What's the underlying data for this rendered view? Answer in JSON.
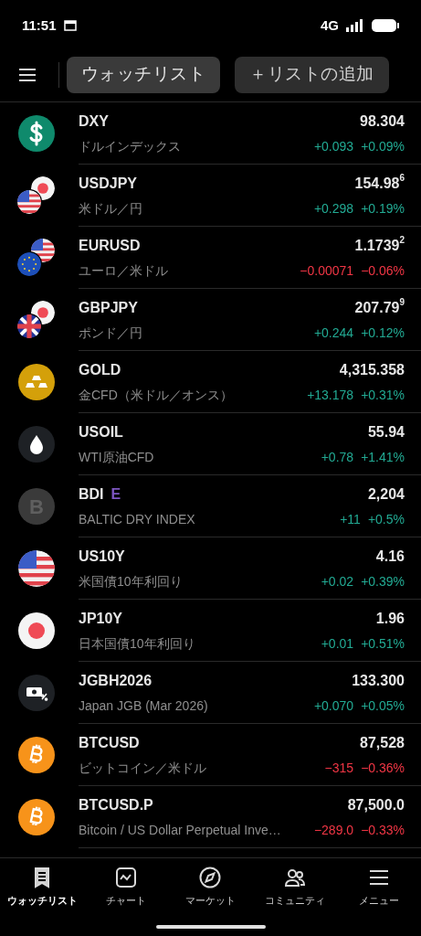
{
  "status_bar": {
    "time": "11:51",
    "network": "4G"
  },
  "header": {
    "tabs": [
      {
        "label": "ウォッチリスト",
        "selected": true
      },
      {
        "label": "＋リストの追加",
        "selected": false
      }
    ]
  },
  "rows": [
    {
      "kind": "dollar",
      "symbol": "DXY",
      "name": "ドルインデックス",
      "price": "98.304",
      "change": "+0.093",
      "percent": "+0.09%",
      "negative": false
    },
    {
      "kind": "usd_jpy",
      "symbol": "USDJPY",
      "name": "米ドル／円",
      "price": "154.98",
      "price_sup": "6",
      "change": "+0.298",
      "percent": "+0.19%",
      "negative": false
    },
    {
      "kind": "eur_usd",
      "symbol": "EURUSD",
      "name": "ユーロ／米ドル",
      "price": "1.1739",
      "price_sup": "2",
      "change": "−0.00071",
      "percent": "−0.06%",
      "negative": true
    },
    {
      "kind": "gbp_jpy",
      "symbol": "GBPJPY",
      "name": "ポンド／円",
      "price": "207.79",
      "price_sup": "9",
      "change": "+0.244",
      "percent": "+0.12%",
      "negative": false
    },
    {
      "kind": "gold",
      "symbol": "GOLD",
      "name": "金CFD（米ドル／オンス）",
      "price": "4,315.358",
      "change": "+13.178",
      "percent": "+0.31%",
      "negative": false
    },
    {
      "kind": "oil",
      "symbol": "USOIL",
      "name": "WTI原油CFD",
      "price": "55.94",
      "change": "+0.78",
      "percent": "+1.41%",
      "negative": false
    },
    {
      "kind": "letter",
      "letter": "B",
      "symbol": "BDI",
      "badge": "E",
      "name": "BALTIC DRY INDEX",
      "price": "2,204",
      "change": "+11",
      "percent": "+0.5%",
      "negative": false
    },
    {
      "kind": "us",
      "symbol": "US10Y",
      "name": "米国債10年利回り",
      "price": "4.16",
      "change": "+0.02",
      "percent": "+0.39%",
      "negative": false
    },
    {
      "kind": "jp",
      "symbol": "JP10Y",
      "name": "日本国債10年利回り",
      "price": "1.96",
      "change": "+0.01",
      "percent": "+0.51%",
      "negative": false
    },
    {
      "kind": "bond",
      "symbol": "JGBH2026",
      "name": "Japan JGB (Mar 2026)",
      "price": "133.300",
      "change": "+0.070",
      "percent": "+0.05%",
      "negative": false
    },
    {
      "kind": "bitcoin",
      "symbol": "BTCUSD",
      "name": "ビットコイン／米ドル",
      "price": "87,528",
      "change": "−315",
      "percent": "−0.36%",
      "negative": true
    },
    {
      "kind": "bitcoin",
      "symbol": "BTCUSD.P",
      "name": "Bitcoin / US Dollar Perpetual Inve…",
      "price": "87,500.0",
      "change": "−289.0",
      "percent": "−0.33%",
      "negative": true
    }
  ],
  "nav": [
    {
      "label": "ウォッチリスト",
      "kind": "list",
      "selected": true
    },
    {
      "label": "チャート",
      "kind": "chart",
      "selected": false
    },
    {
      "label": "マーケット",
      "kind": "compass",
      "selected": false
    },
    {
      "label": "コミュニティ",
      "kind": "people",
      "selected": false
    },
    {
      "label": "メニュー",
      "kind": "menu",
      "selected": false
    }
  ]
}
